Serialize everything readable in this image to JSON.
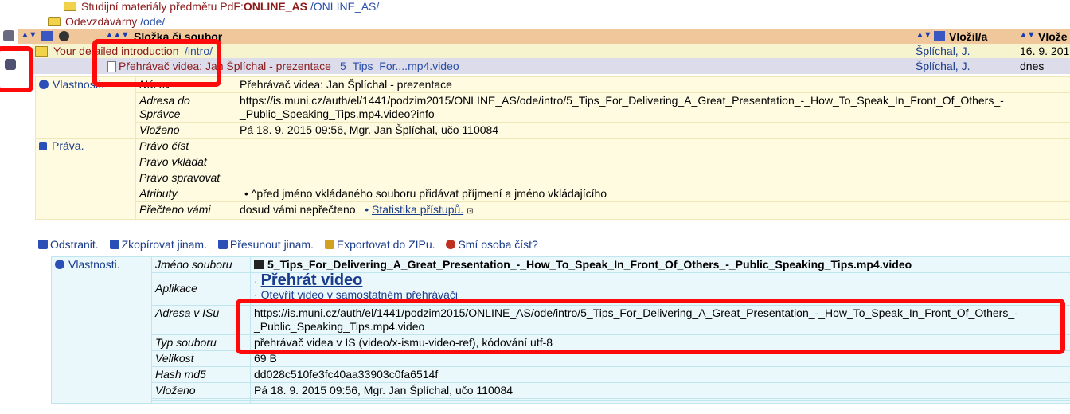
{
  "breadcrumb": {
    "line1_label": "Studijní materiály předmětu PdF:",
    "line1_code": "ONLINE_AS",
    "line1_path": "/ONLINE_AS/",
    "line2_label": "Odevzdávárny",
    "line2_path": "/ode/"
  },
  "header": {
    "name_col": "Složka či soubor",
    "author_col": "Vložil/a",
    "date_col": "Vlože"
  },
  "rows": [
    {
      "name": "Your detailed introduction",
      "path": "/intro/",
      "author": "Šplíchal, J.",
      "date": "16. 9. 201"
    },
    {
      "name_prefix": "Přehrávač videa: Jan Šplíchal - prezentace",
      "file": "5_Tips_For....mp4.video",
      "author": "Šplíchal, J.",
      "date": "dnes"
    }
  ],
  "properties": {
    "section_label": "Vlastnosti.",
    "fields": [
      {
        "label": "Název",
        "value": "Přehrávač videa: Jan Šplíchal - prezentace"
      },
      {
        "label": "Adresa do Správce",
        "value": "https://is.muni.cz/auth/el/1441/podzim2015/ONLINE_AS/ode/intro/5_Tips_For_Delivering_A_Great_Presentation_-_How_To_Speak_In_Front_Of_Others_-_Public_Speaking_Tips.mp4.video?info"
      },
      {
        "label": "Vloženo",
        "value": "Pá 18. 9. 2015 09:56, Mgr. Jan Šplíchal, učo 110084"
      }
    ]
  },
  "rights": {
    "section_label": "Práva.",
    "fields": [
      {
        "label": "Právo číst",
        "value": ""
      },
      {
        "label": "Právo vkládat",
        "value": ""
      },
      {
        "label": "Právo spravovat",
        "value": ""
      },
      {
        "label": "Atributy",
        "value": "• ^před jméno vkládaného souboru přidávat příjmení a jméno vkládajícího"
      },
      {
        "label": "Přečteno vámi",
        "value": "dosud vámi nepřečteno",
        "stat_link": "Statistika přístupů."
      }
    ]
  },
  "actions": [
    {
      "label": "Odstranit."
    },
    {
      "label": "Zkopírovat jinam."
    },
    {
      "label": "Přesunout jinam."
    },
    {
      "label": "Exportovat do ZIPu."
    },
    {
      "label": "Smí osoba číst?"
    }
  ],
  "file_properties": {
    "section_label": "Vlastnosti.",
    "filename_label": "Jméno souboru",
    "filename": "5_Tips_For_Delivering_A_Great_Presentation_-_How_To_Speak_In_Front_Of_Others_-_Public_Speaking_Tips.mp4.video",
    "app_label": "Aplikace",
    "play_link": "Přehrát video",
    "open_link": "Otevřít video v samostatném přehrávači",
    "address_label": "Adresa v ISu",
    "address": "https://is.muni.cz/auth/el/1441/podzim2015/ONLINE_AS/ode/intro/5_Tips_For_Delivering_A_Great_Presentation_-_How_To_Speak_In_Front_Of_Others_-_Public_Speaking_Tips.mp4.video",
    "type_label": "Typ souboru",
    "type": "přehrávač videa v IS (video/x-ismu-video-ref), kódování utf-8",
    "size_label": "Velikost",
    "size": "69 B",
    "hash_label": "Hash md5",
    "hash": "dd028c510fe3fc40aa33903c0fa6514f",
    "inserted_label": "Vloženo",
    "inserted": "Pá 18. 9. 2015 09:56, Mgr. Jan Šplíchal, učo 110084"
  },
  "colors": {
    "annotation_red": "#ff0a0a",
    "header_bar": "#efc79b",
    "link_blue": "#1a3c8c"
  }
}
